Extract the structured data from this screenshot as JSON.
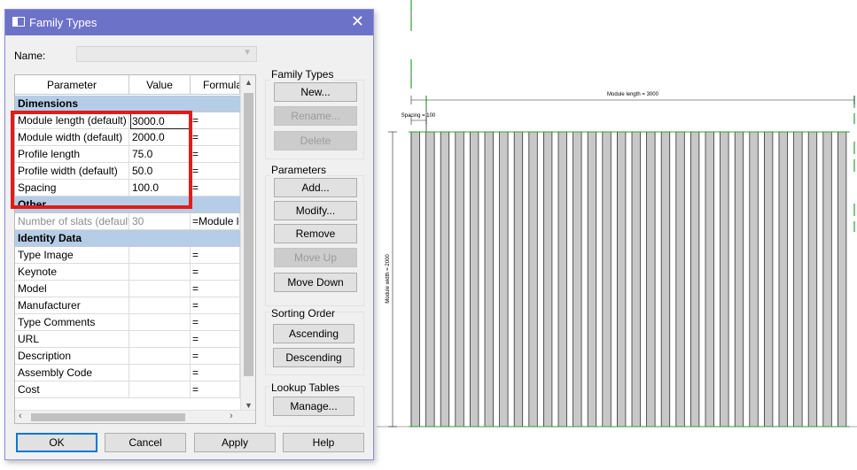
{
  "dialog": {
    "title": "Family Types",
    "name_label": "Name:",
    "name_value": "",
    "columns": [
      "Parameter",
      "Value",
      "Formula"
    ],
    "groups": [
      {
        "label": "Dimensions",
        "rows": [
          {
            "param": "Module length (default)",
            "value": "3000.0",
            "formula": "="
          },
          {
            "param": "Module width (default)",
            "value": "2000.0",
            "formula": "="
          },
          {
            "param": "Profile length",
            "value": "75.0",
            "formula": "="
          },
          {
            "param": "Profile width (default)",
            "value": "50.0",
            "formula": "="
          },
          {
            "param": "Spacing",
            "value": "100.0",
            "formula": "="
          }
        ]
      },
      {
        "label": "Other",
        "rows": [
          {
            "param": "Number of slats (default)",
            "value": "30",
            "formula": "=Module le"
          }
        ]
      },
      {
        "label": "Identity Data",
        "rows": [
          {
            "param": "Type Image",
            "value": "",
            "formula": "="
          },
          {
            "param": "Keynote",
            "value": "",
            "formula": "="
          },
          {
            "param": "Model",
            "value": "",
            "formula": "="
          },
          {
            "param": "Manufacturer",
            "value": "",
            "formula": "="
          },
          {
            "param": "Type Comments",
            "value": "",
            "formula": "="
          },
          {
            "param": "URL",
            "value": "",
            "formula": "="
          },
          {
            "param": "Description",
            "value": "",
            "formula": "="
          },
          {
            "param": "Assembly Code",
            "value": "",
            "formula": "="
          },
          {
            "param": "Cost",
            "value": "",
            "formula": "="
          }
        ]
      }
    ],
    "family_types": {
      "title": "Family Types",
      "new": "New...",
      "rename": "Rename...",
      "delete": "Delete"
    },
    "parameters": {
      "title": "Parameters",
      "add": "Add...",
      "modify": "Modify...",
      "remove": "Remove",
      "move_up": "Move Up",
      "move_down": "Move Down"
    },
    "sorting": {
      "title": "Sorting Order",
      "ascending": "Ascending",
      "descending": "Descending"
    },
    "lookup": {
      "title": "Lookup Tables",
      "manage": "Manage..."
    },
    "footer": {
      "ok": "OK",
      "cancel": "Cancel",
      "apply": "Apply",
      "help": "Help"
    }
  },
  "drawing": {
    "module_length_label": "Module length = 3000",
    "spacing_label": "Spacing = 100",
    "module_width_label": "Module width = 2000",
    "slat_count": 30,
    "colors": {
      "slat_fill": "#c8c8c8",
      "slat_stroke": "#333333",
      "ref_line": "#2e9e3a"
    }
  }
}
